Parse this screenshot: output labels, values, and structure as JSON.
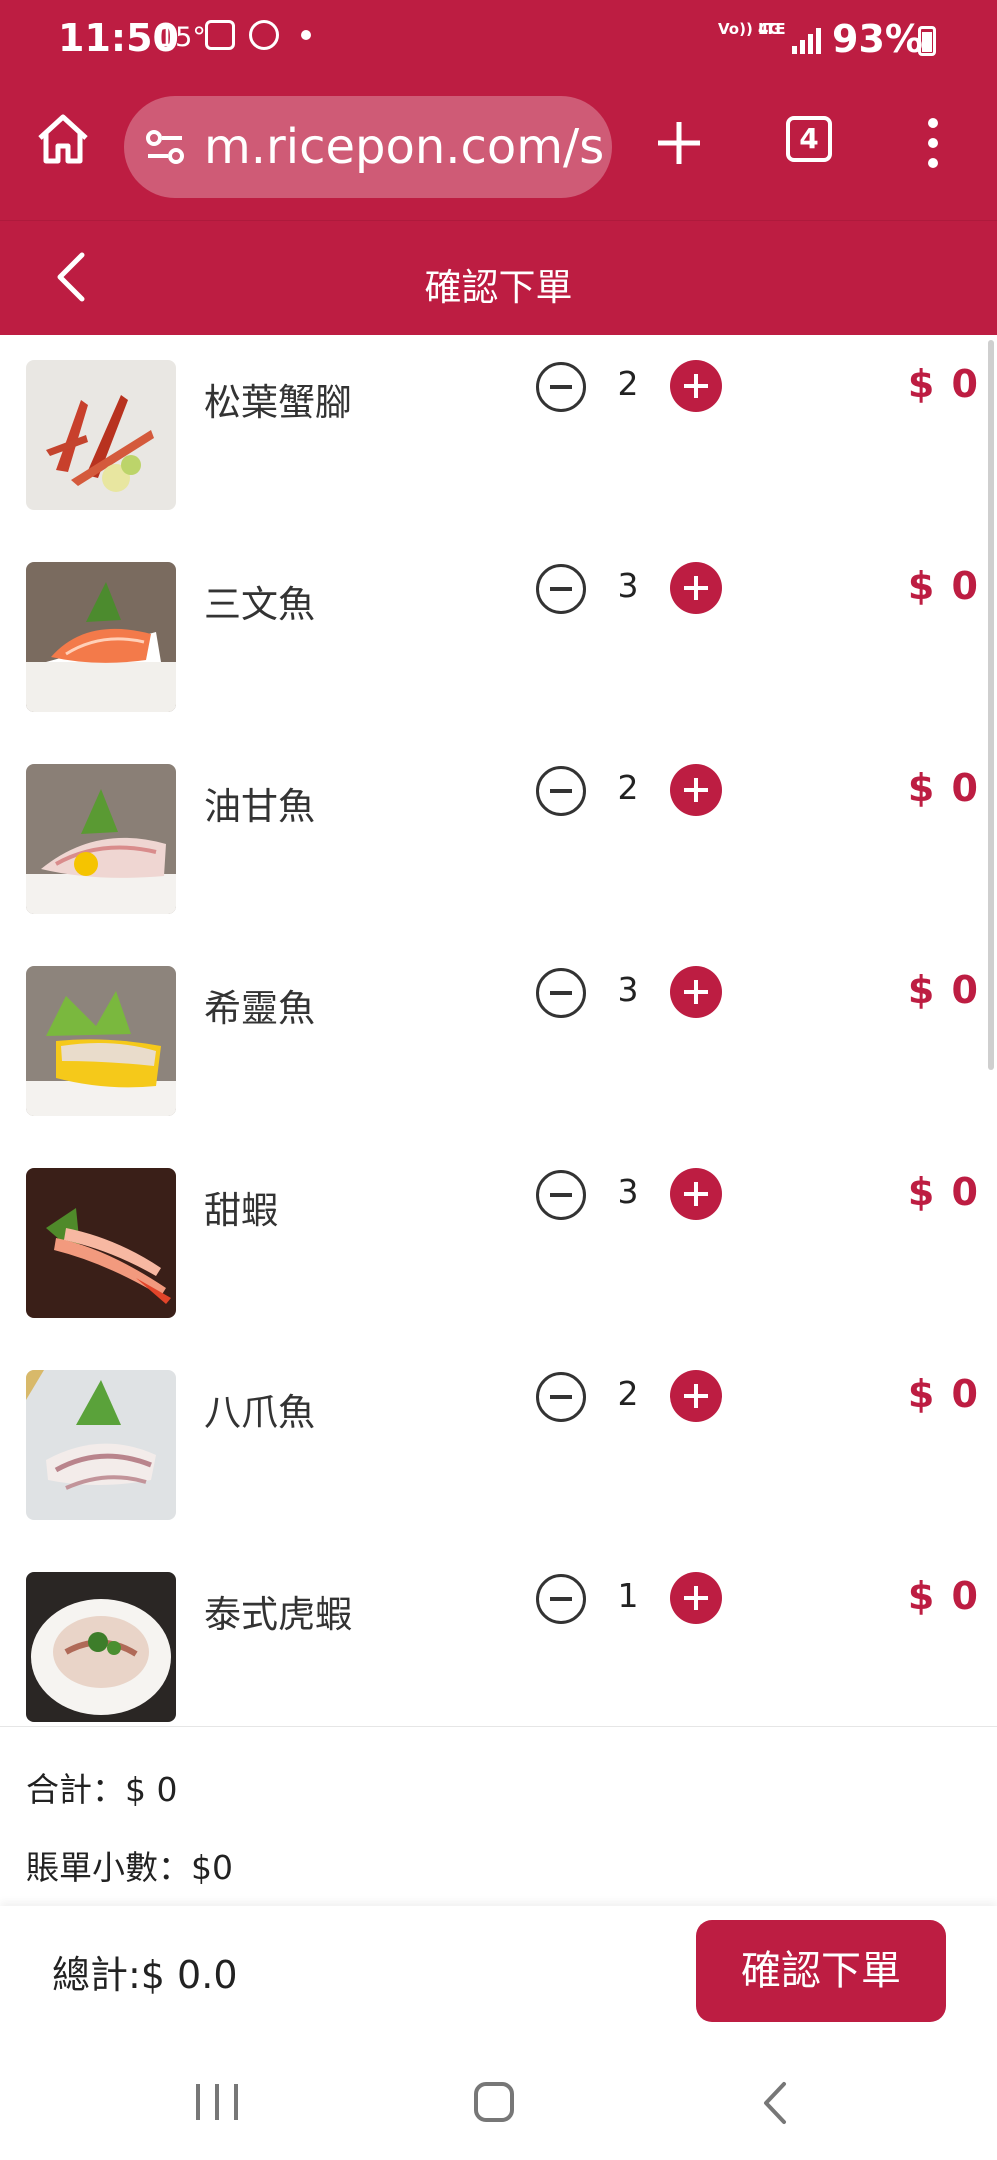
{
  "status_bar": {
    "time": "11:50",
    "temperature": "15°",
    "network": "Vo)) LTE",
    "network_type": "4G",
    "battery": "93%"
  },
  "browser": {
    "url": "m.ricepon.com/s",
    "tab_count": "4"
  },
  "header": {
    "title": "確認下單"
  },
  "items": [
    {
      "name": "松葉蟹腳",
      "qty": "2",
      "price": "$ 0"
    },
    {
      "name": "三文魚",
      "qty": "3",
      "price": "$ 0"
    },
    {
      "name": "油甘魚",
      "qty": "2",
      "price": "$ 0"
    },
    {
      "name": "希靈魚",
      "qty": "3",
      "price": "$ 0"
    },
    {
      "name": "甜蝦",
      "qty": "3",
      "price": "$ 0"
    },
    {
      "name": "八爪魚",
      "qty": "2",
      "price": "$ 0"
    },
    {
      "name": "泰式虎蝦",
      "qty": "1",
      "price": "$ 0"
    }
  ],
  "summary": {
    "subtotal": "合計：$ 0",
    "decimal": "賬單小數：$0"
  },
  "footer": {
    "total": "總計:$ 0.0",
    "confirm_label": "確認下單"
  },
  "colors": {
    "brand": "#bd1d42"
  }
}
